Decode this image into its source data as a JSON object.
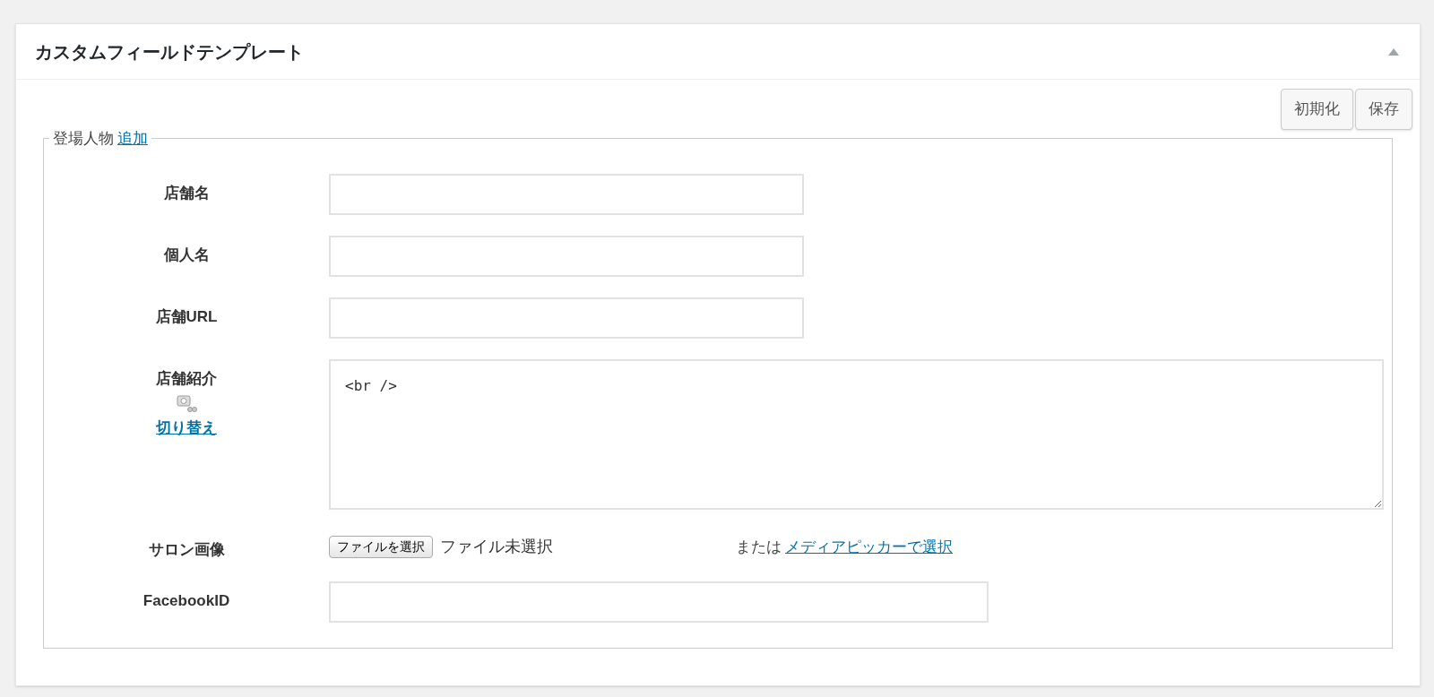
{
  "panel": {
    "title": "カスタムフィールドテンプレート",
    "expanded": true
  },
  "buttons": [
    {
      "label": "初期化"
    },
    {
      "label": "保存"
    }
  ],
  "group": {
    "legend": "登場人物",
    "add_link": "追加"
  },
  "fields": [
    {
      "kind": "text",
      "label": "店舗名",
      "wide": false
    },
    {
      "kind": "text",
      "label": "個人名",
      "wide": false
    },
    {
      "kind": "text",
      "label": "店舗URL",
      "wide": false
    },
    {
      "kind": "textarea",
      "label": "店舗紹介",
      "value": "<br />",
      "toggle_link": "切り替え"
    },
    {
      "kind": "file",
      "label": "サロン画像",
      "button": "ファイルを選択",
      "status": "ファイル未選択",
      "or_text": "または",
      "picker_link": "メディアピッカーで選択"
    },
    {
      "kind": "text",
      "label": "FacebookID",
      "wide": true
    }
  ]
}
